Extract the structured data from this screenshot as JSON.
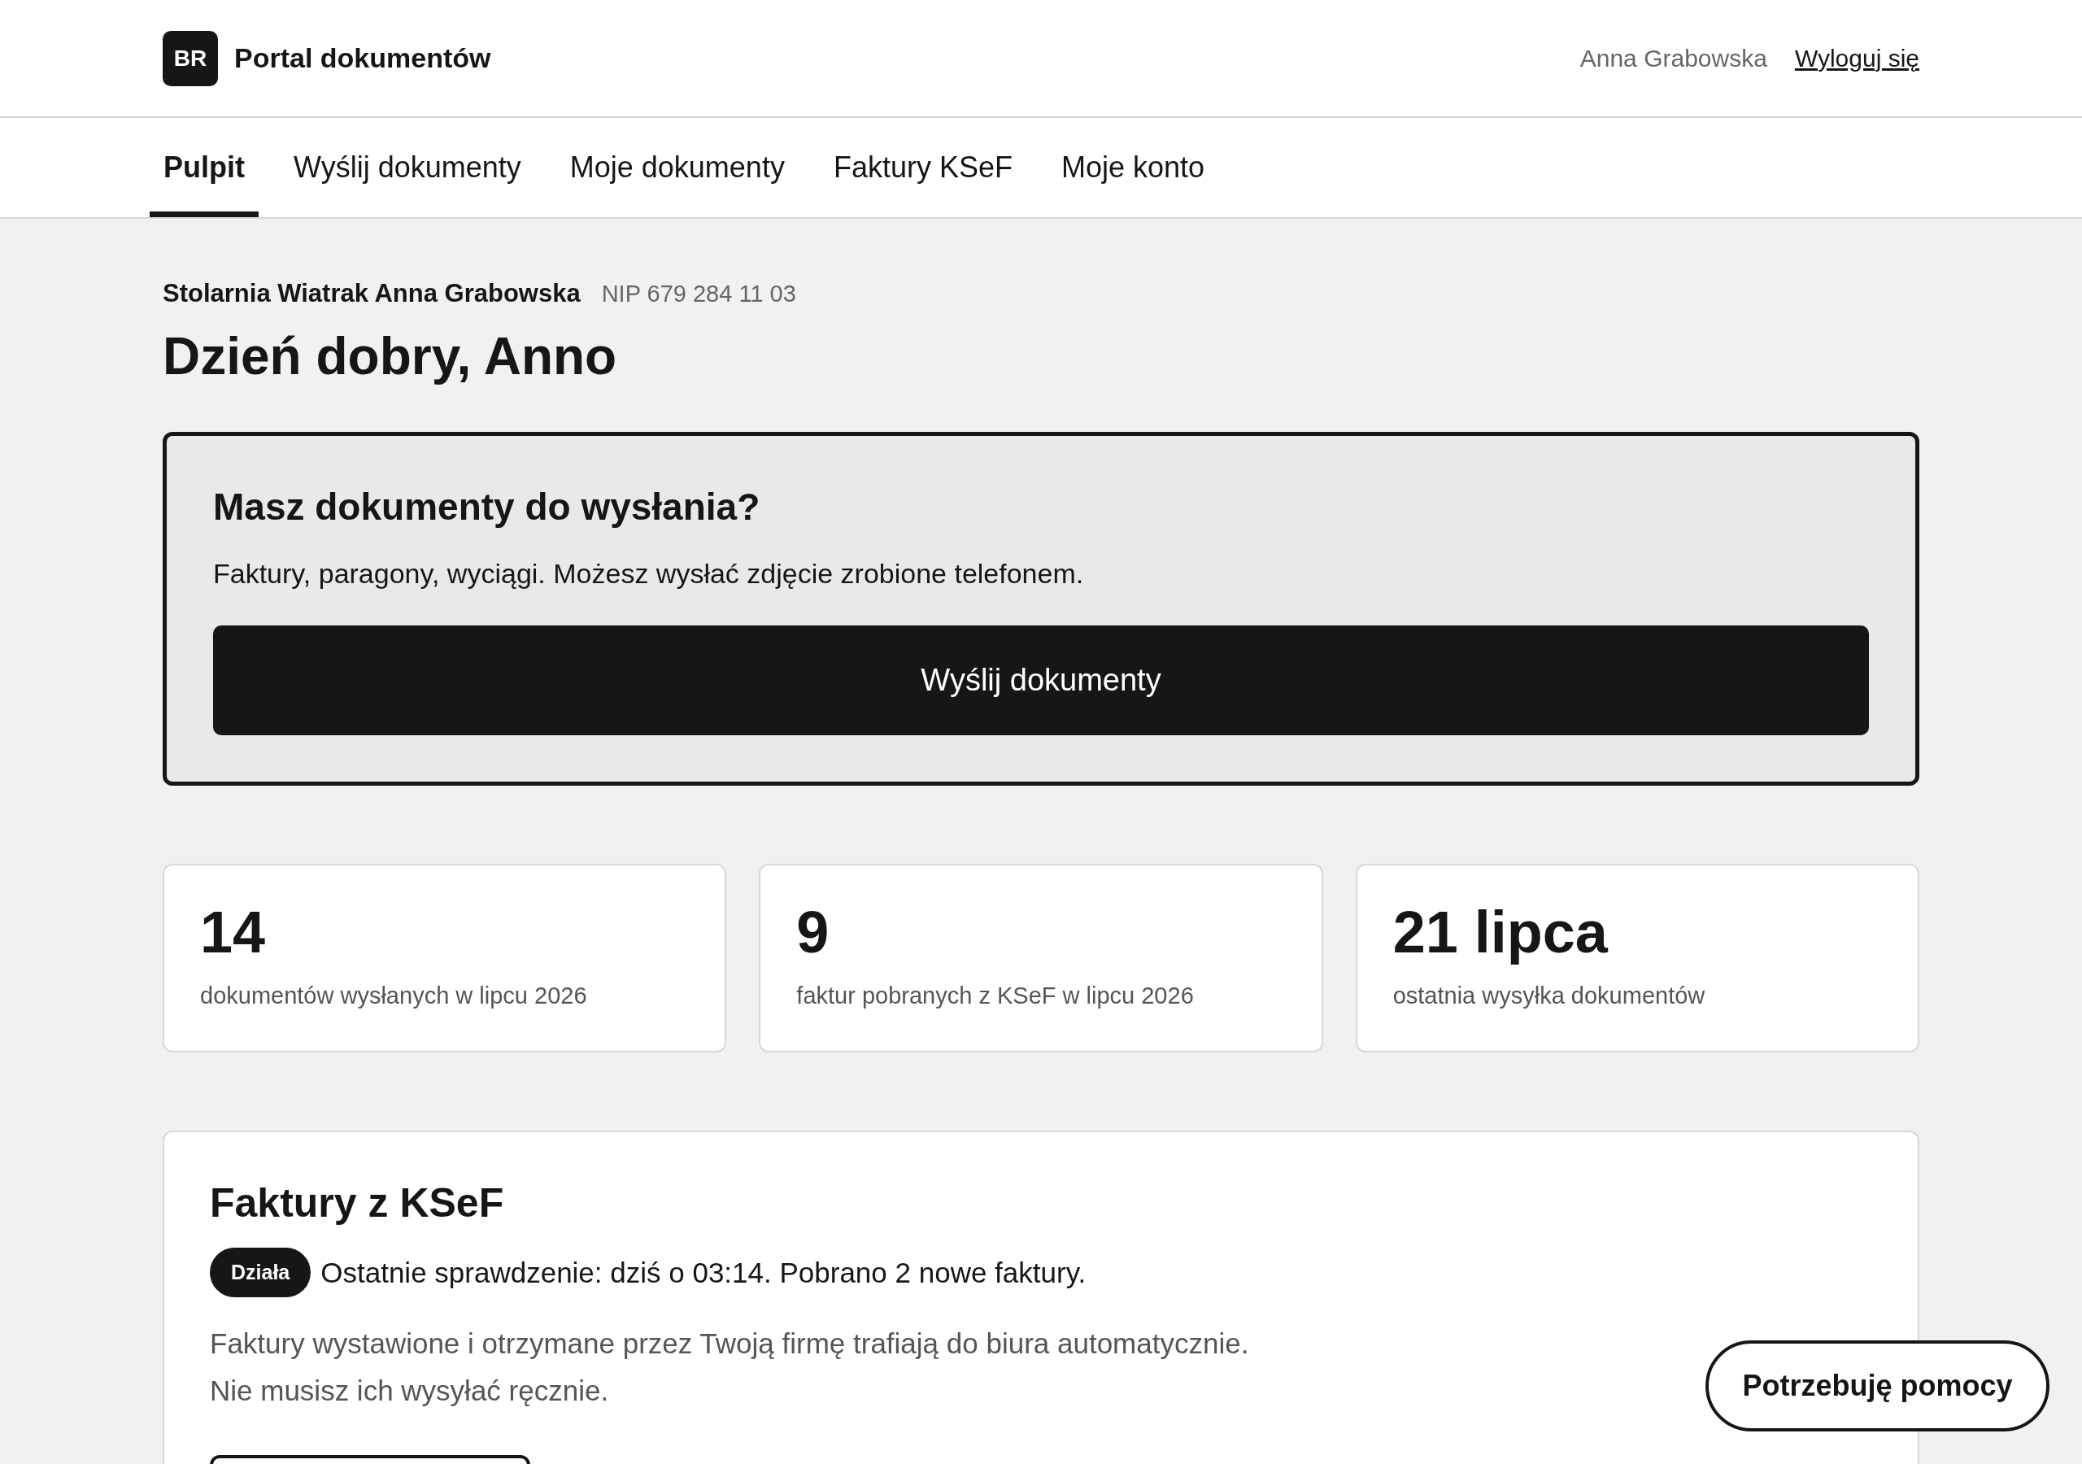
{
  "header": {
    "logo": "BR",
    "title": "Portal dokumentów",
    "user": "Anna Grabowska",
    "logout": "Wyloguj się"
  },
  "tabs": [
    {
      "label": "Pulpit",
      "selected": true
    },
    {
      "label": "Wyślij dokumenty",
      "selected": false
    },
    {
      "label": "Moje dokumenty",
      "selected": false
    },
    {
      "label": "Faktury KSeF",
      "selected": false
    },
    {
      "label": "Moje konto",
      "selected": false
    }
  ],
  "company": {
    "name": "Stolarnia Wiatrak Anna Grabowska",
    "nip": "NIP 679 284 11 03"
  },
  "greeting": "Dzień dobry, Anno",
  "upload_card": {
    "title": "Masz dokumenty do wysłania?",
    "text": "Faktury, paragony, wyciągi. Możesz wysłać zdjęcie zrobione telefonem.",
    "button": "Wyślij dokumenty"
  },
  "stats": [
    {
      "value": "14",
      "label": "dokumentów wysłanych w lipcu 2026"
    },
    {
      "value": "9",
      "label": "faktur pobranych z KSeF w lipcu 2026"
    },
    {
      "value": "21 lipca",
      "label": "ostatnia wysyłka dokumentów"
    }
  ],
  "ksef": {
    "title": "Faktury z KSeF",
    "status": "Działa",
    "status_ok": true,
    "check": "Ostatnie sprawdzenie: dziś o 03:14. Pobrano 2 nowe faktury.",
    "lines": [
      "Faktury wystawione i otrzymane przez Twoją firmę trafiają do biura automatycznie.",
      "Nie musisz ich wysyłać ręcznie."
    ]
  },
  "help_button": "Potrzebuję pomocy"
}
